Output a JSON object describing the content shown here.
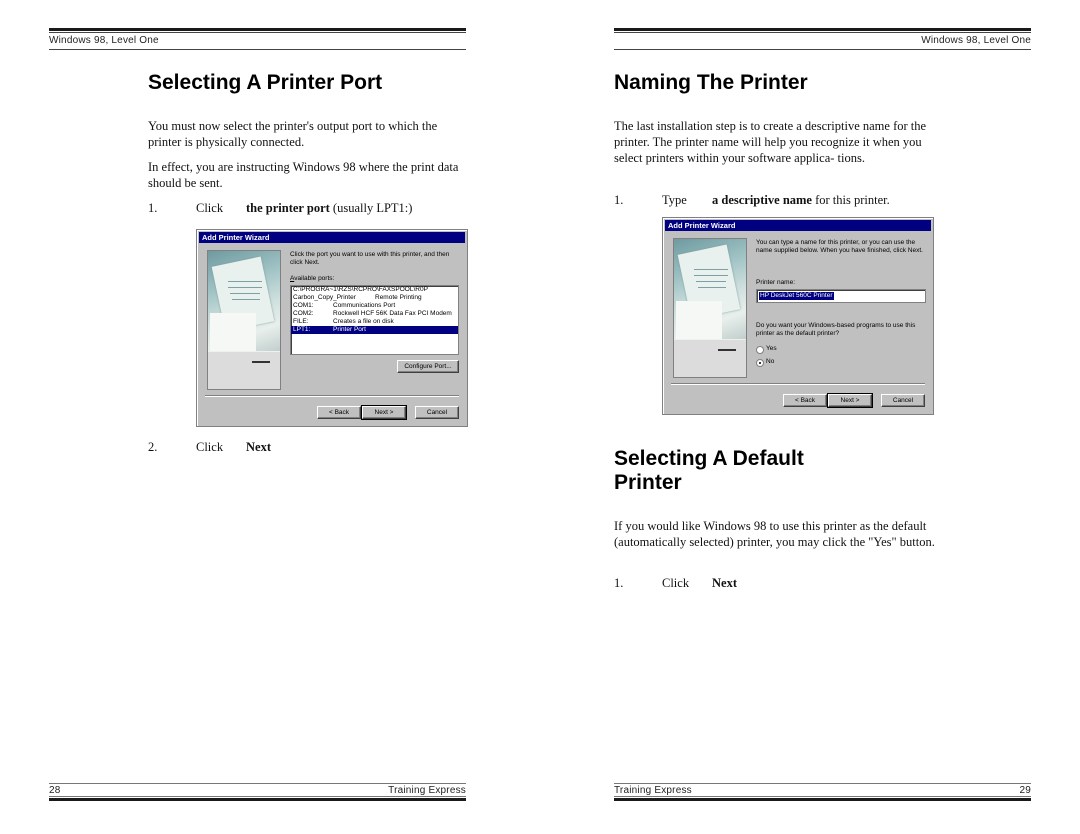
{
  "left_page": {
    "header": "Windows 98, Level One",
    "title": "Selecting A Printer Port",
    "paragraphs": [
      "You must now select the printer's output port to which the printer is physically connected.",
      "In effect, you are instructing Windows 98 where the print data should be sent."
    ],
    "step1": {
      "num": "1.",
      "verb": "Click",
      "bold": "the printer port",
      "rest": " (usually LPT1:)"
    },
    "step2": {
      "num": "2.",
      "verb": "Click",
      "bold": "Next"
    },
    "footer": {
      "page_number": "28",
      "label": "Training Express"
    },
    "dialog": {
      "title": "Add Printer Wizard",
      "instructions": "Click the port you want to use with this printer, and then click Next.",
      "ports_label": "Available ports:",
      "ports": [
        {
          "name": "C:\\PROGRA~1\\RZS\\RCPRO\\FAXSPOOL\\R0P",
          "desc": ""
        },
        {
          "name": "Carbon_Copy_Printer",
          "desc": "Remote Printing"
        },
        {
          "name": "COM1:",
          "desc": "Communications Port"
        },
        {
          "name": "COM2:",
          "desc": "Rockwell HCF 56K Data Fax PCI Modem"
        },
        {
          "name": "FILE:",
          "desc": "Creates a file on disk"
        },
        {
          "name": "LPT1:",
          "desc": "Printer Port",
          "selected": true
        }
      ],
      "configure_button": "Configure Port...",
      "back_button": "< Back",
      "next_button": "Next >",
      "cancel_button": "Cancel"
    }
  },
  "right_page": {
    "header": "Windows 98, Level One",
    "title": "Naming The Printer",
    "paragraph": "The last installation step is to create a descriptive name for the printer. The printer name will help you recognize it when you select printers within your software applica- tions.",
    "step1": {
      "num": "1.",
      "verb": "Type",
      "bold": "a descriptive name",
      "rest": " for this printer."
    },
    "section2_title_line1": "Selecting A Default",
    "section2_title_line2": "Printer",
    "section2_paragraph": "If you would like Windows 98 to use this printer as the default (automatically selected) printer, you may click the \"Yes\" button.",
    "section2_step1": {
      "num": "1.",
      "verb": "Click",
      "bold": "Next"
    },
    "footer": {
      "page_number": "29",
      "label": "Training Express"
    },
    "dialog": {
      "title": "Add Printer Wizard",
      "instructions": "You can type a name for this printer, or you can use the name supplied below. When you have finished, click Next.",
      "printer_name_label": "Printer name:",
      "printer_name_value": "HP DeskJet 560C Printer",
      "default_question": "Do you want your Windows-based programs to use this printer as the default printer?",
      "radio_yes": "Yes",
      "radio_no": "No",
      "selected_radio": "No",
      "back_button": "< Back",
      "next_button": "Next >",
      "cancel_button": "Cancel"
    }
  }
}
